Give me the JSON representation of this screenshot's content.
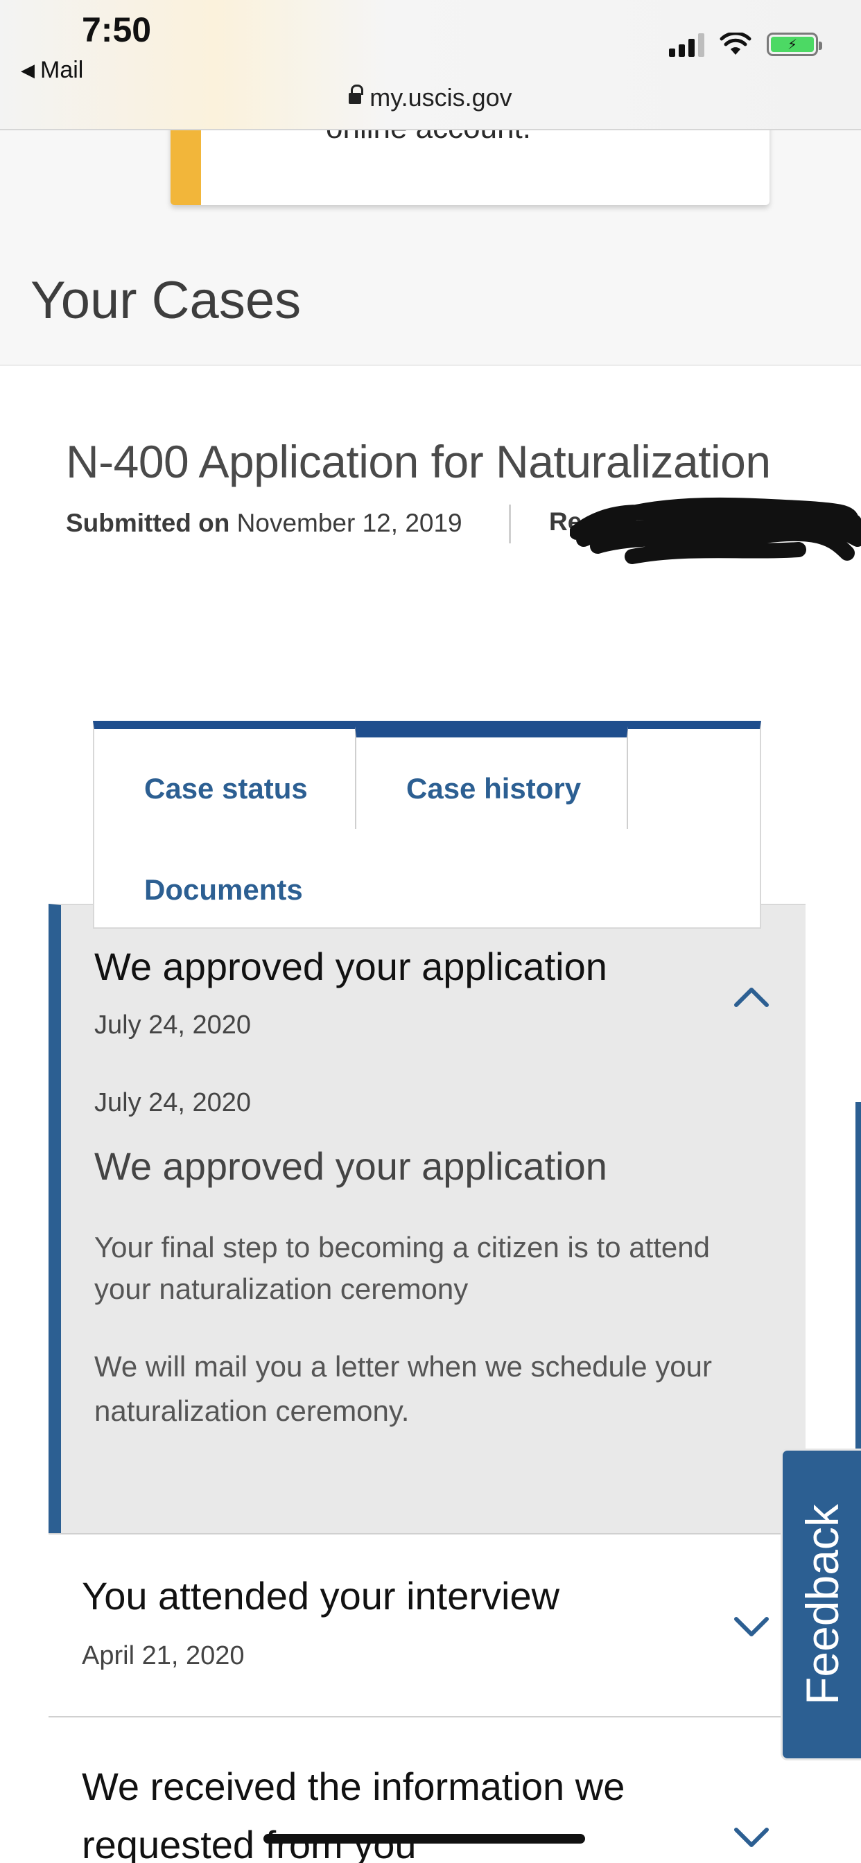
{
  "status_bar": {
    "time": "7:50",
    "back_app": "Mail",
    "url": "my.uscis.gov",
    "battery_color": "#4cd964"
  },
  "alert": {
    "text": "online account.",
    "accent_color": "#f2b63a"
  },
  "section_heading": "Your Cases",
  "case": {
    "title": "N-400 Application for Naturalization",
    "submitted_label": "Submitted on",
    "submitted_date": "November 12, 2019",
    "receipt_label_partial": "Recei"
  },
  "tabs": [
    {
      "label": "Case status",
      "active": false
    },
    {
      "label": "Case history",
      "active": true
    },
    {
      "label": "Documents",
      "active": false
    }
  ],
  "timeline": [
    {
      "title": "We approved your application",
      "date": "July 24, 2020",
      "expanded": true,
      "detail": {
        "date": "July 24, 2020",
        "title": "We approved your application",
        "paragraphs": [
          "Your final step to becoming a citizen is to attend your naturalization ceremony",
          "We will mail you a letter when we schedule your naturalization ceremony."
        ]
      }
    },
    {
      "title": "You attended your interview",
      "date": "April 21, 2020",
      "expanded": false
    },
    {
      "title": "We received the information we requested from you",
      "expanded": false
    }
  ],
  "feedback_label": "Feedback",
  "colors": {
    "brand_blue": "#2c5f92",
    "tab_accent": "#1f4e8d"
  }
}
